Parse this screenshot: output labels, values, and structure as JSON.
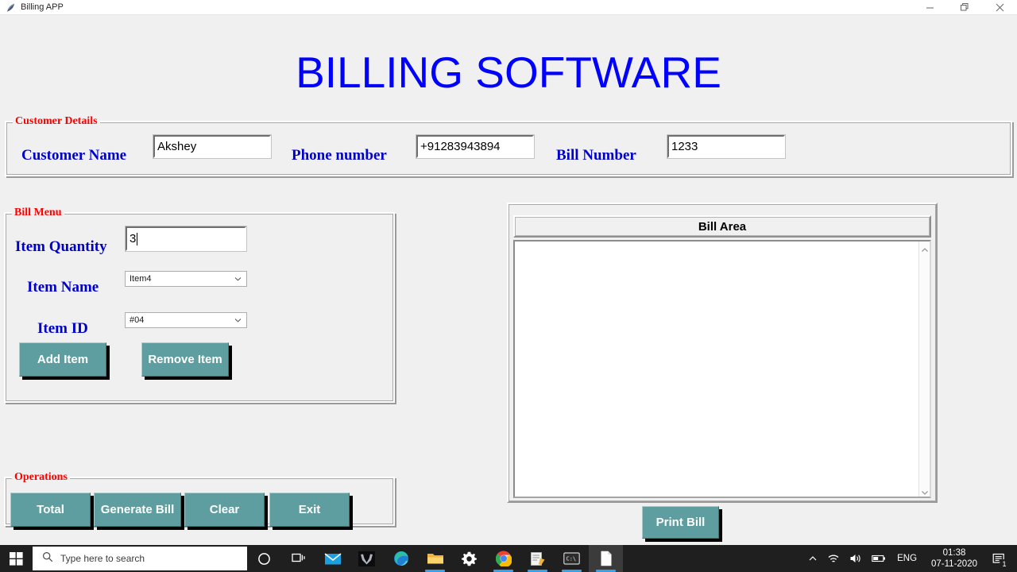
{
  "window": {
    "title": "Billing APP",
    "icon": "feather-icon",
    "controls": {
      "minimize": "–",
      "restore": "❐",
      "close": "✕"
    }
  },
  "app": {
    "title": "BILLING SOFTWARE",
    "title_color": "#0000ff",
    "background": "#f0f0f0",
    "accent_button_color": "#5f9ea0",
    "legend_color": "#ff0000",
    "label_color": "#0000cd"
  },
  "customer_details": {
    "legend": "Customer Details",
    "fields": [
      {
        "label": "Customer Name",
        "value": "Akshey",
        "placeholder": ""
      },
      {
        "label": "Phone number",
        "value": "+91283943894",
        "placeholder": ""
      },
      {
        "label": "Bill Number",
        "value": "1233",
        "placeholder": ""
      }
    ]
  },
  "bill_menu": {
    "legend": "Bill Menu",
    "quantity": {
      "label": "Item Quantity",
      "value": "3"
    },
    "item_name": {
      "label": "Item Name",
      "value": "Item4"
    },
    "item_id": {
      "label": "Item ID",
      "value": "#04"
    },
    "buttons": [
      {
        "label": "Add Item"
      },
      {
        "label": "Remove Item"
      }
    ]
  },
  "operations": {
    "legend": "Operations",
    "buttons": [
      {
        "label": "Total"
      },
      {
        "label": "Generate Bill"
      },
      {
        "label": "Clear"
      },
      {
        "label": "Exit"
      }
    ]
  },
  "bill_area": {
    "header": "Bill Area",
    "content": ""
  },
  "print": {
    "label": "Print Bill"
  },
  "taskbar": {
    "search_placeholder": "Type here to search",
    "apps": [
      {
        "name": "cortana-icon"
      },
      {
        "name": "task-view-icon"
      },
      {
        "name": "mail-icon"
      },
      {
        "name": "predator-icon"
      },
      {
        "name": "edge-icon"
      },
      {
        "name": "file-explorer-icon"
      },
      {
        "name": "settings-gear-icon"
      },
      {
        "name": "chrome-icon"
      },
      {
        "name": "notes-app-icon"
      },
      {
        "name": "terminal-icon"
      },
      {
        "name": "python-app-icon"
      }
    ],
    "tray": {
      "language": "ENG",
      "time": "01:38",
      "date": "07-11-2020",
      "notification_count": "1"
    }
  }
}
